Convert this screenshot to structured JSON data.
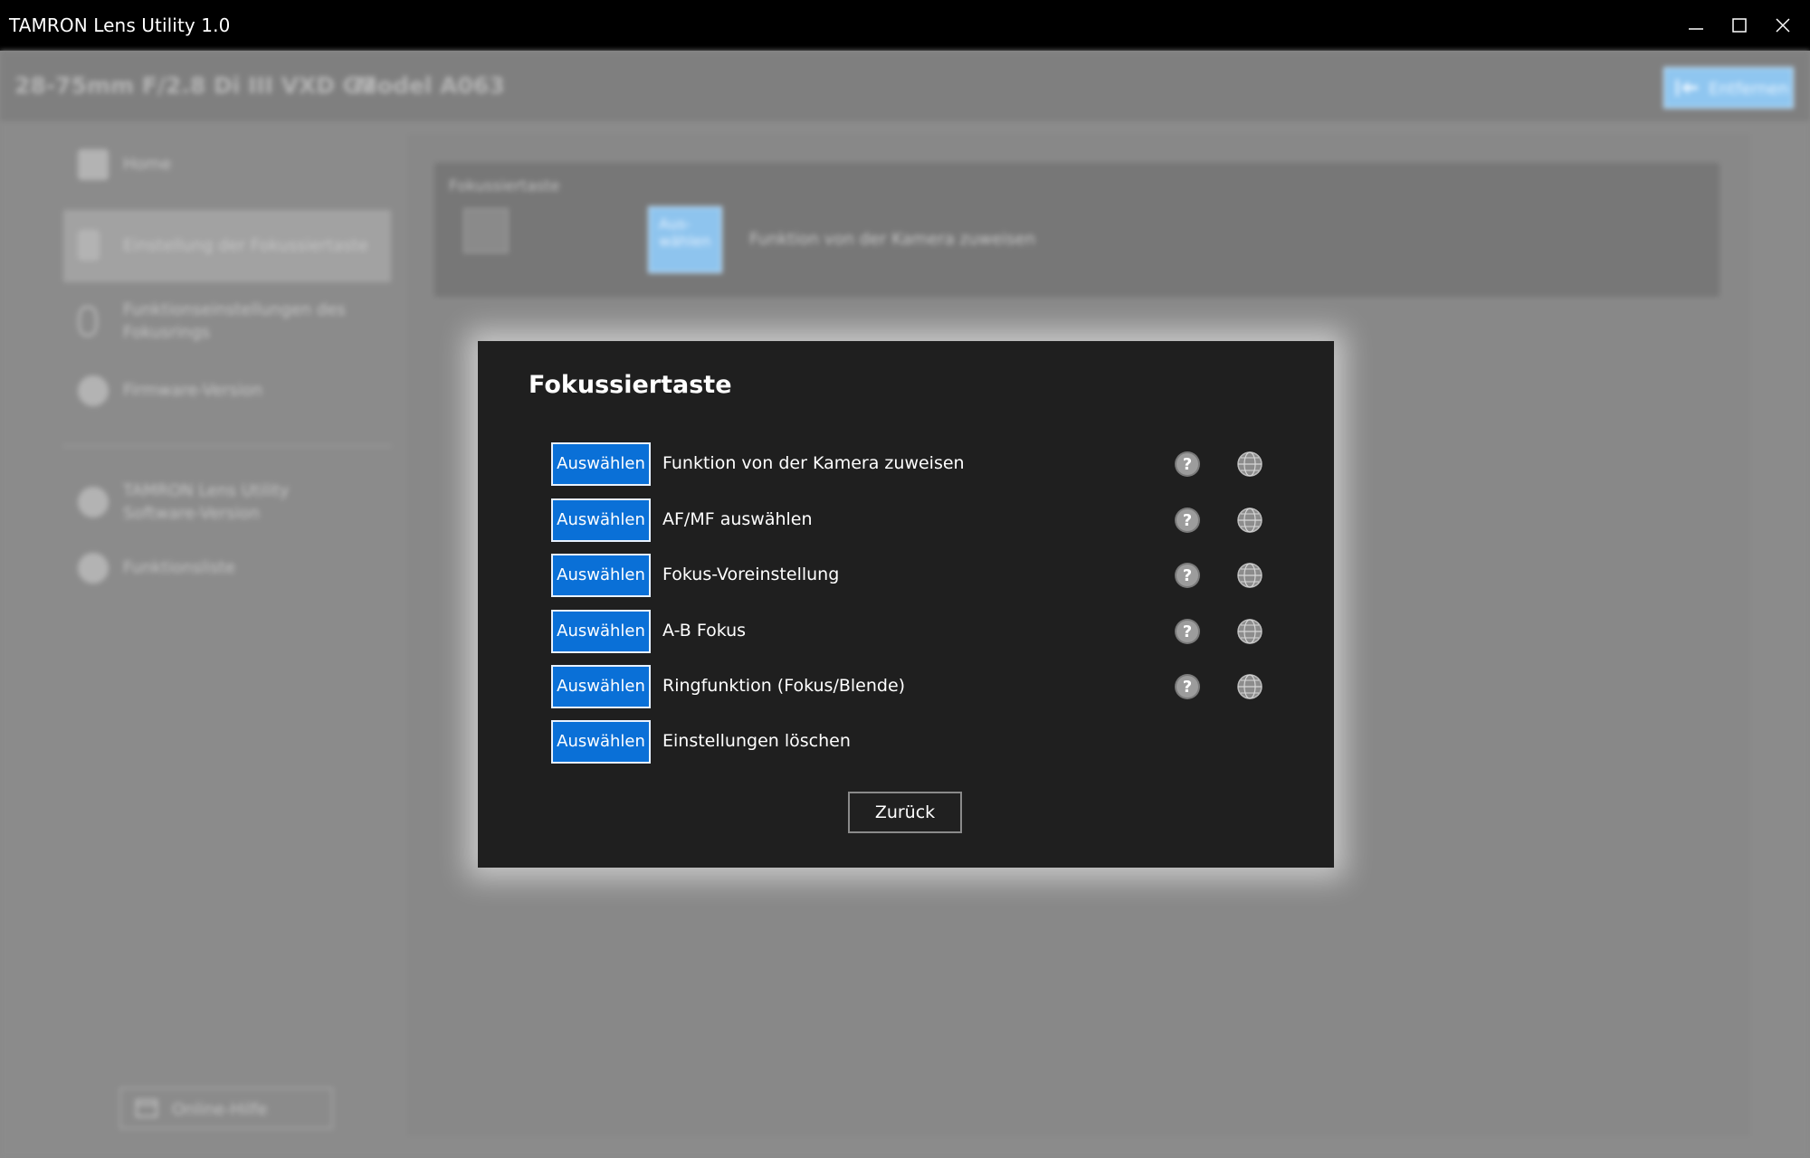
{
  "window": {
    "title": "TAMRON Lens Utility 1.0",
    "controls": [
      "minimize",
      "maximize",
      "close"
    ]
  },
  "header": {
    "lens_name": "28-75mm F/2.8 Di III VXD G2",
    "model": "Model A063",
    "remove_label": "Entfernen"
  },
  "sidebar": {
    "items": [
      {
        "label": "Home",
        "icon": "home-icon"
      },
      {
        "label": "Einstellung der Fokussiertaste",
        "icon": "touch-icon",
        "active": true
      },
      {
        "label": "Funktionseinstellungen des Fokusrings",
        "icon": "focus-ring-icon"
      },
      {
        "label": "Firmware-Version",
        "icon": "firmware-icon"
      },
      {
        "label": "TAMRON Lens Utility Software-Version",
        "icon": "info-icon"
      },
      {
        "label": "Funktionsliste",
        "icon": "list-icon"
      }
    ],
    "online_help": "Online-Hilfe"
  },
  "main": {
    "card_caption": "Fokussiertaste",
    "card_select_label": "Aus-wählen",
    "card_function": "Funktion von der Kamera zuweisen"
  },
  "dialog": {
    "title": "Fokussiertaste",
    "select_label": "Auswählen",
    "options": [
      {
        "label": "Funktion von der Kamera zuweisen",
        "has_help": true
      },
      {
        "label": "AF/MF auswählen",
        "has_help": true
      },
      {
        "label": "Fokus-Voreinstellung",
        "has_help": true
      },
      {
        "label": "A-B Fokus",
        "has_help": true
      },
      {
        "label": "Ringfunktion (Fokus/Blende)",
        "has_help": true
      },
      {
        "label": "Einstellungen löschen",
        "has_help": false
      }
    ],
    "back_label": "Zurück"
  },
  "colors": {
    "accent": "#0a70d7",
    "dialog_bg": "#1f1f1f",
    "titlebar_bg": "#000000"
  }
}
